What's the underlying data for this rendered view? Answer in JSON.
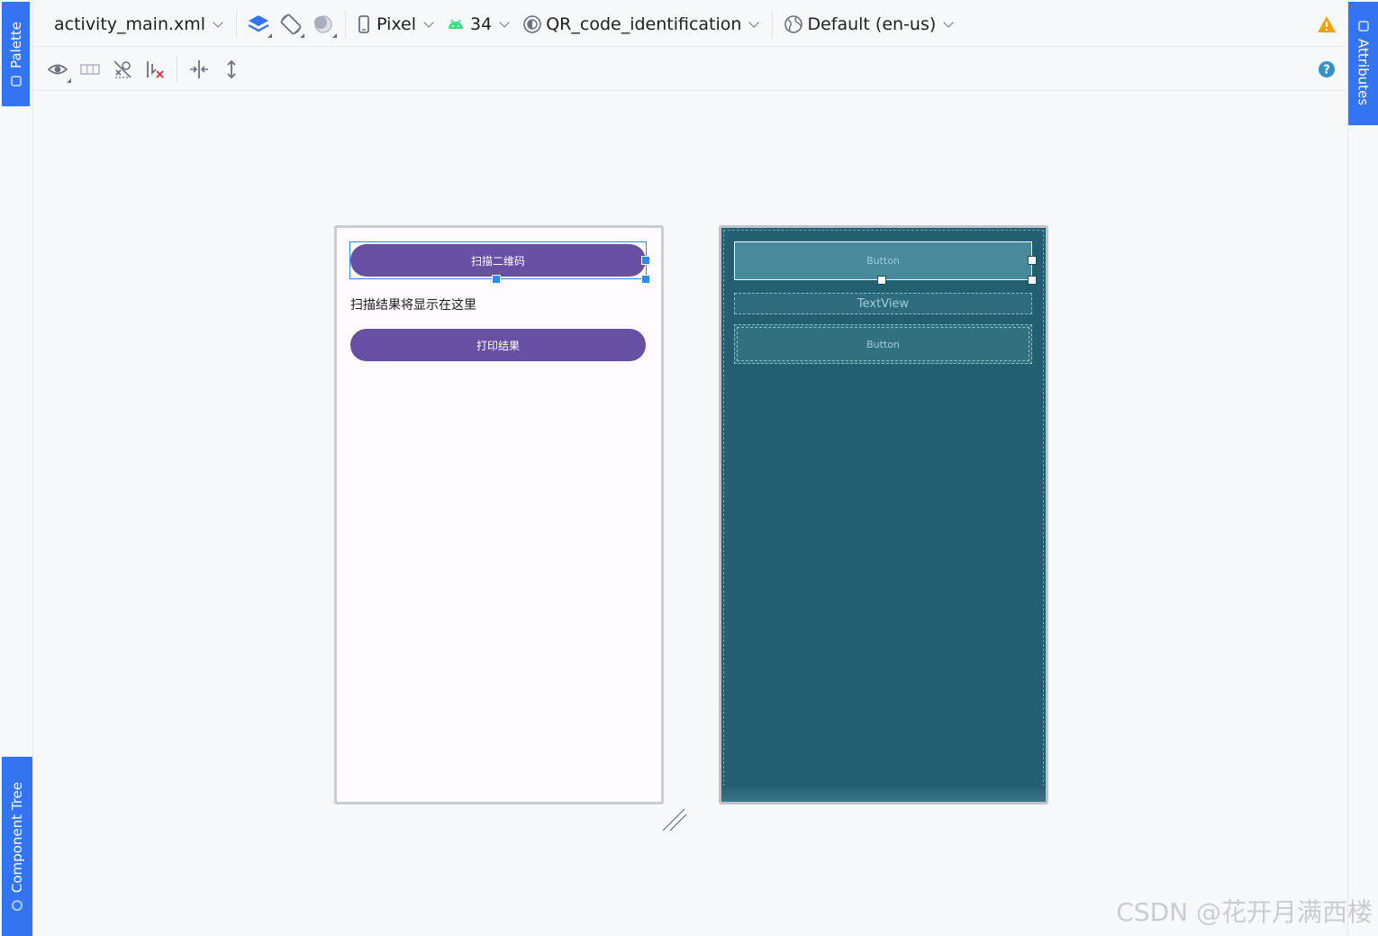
{
  "toolbar": {
    "file_name": "activity_main.xml",
    "device": "Pixel",
    "api_level": "34",
    "theme": "QR_code_identification",
    "locale": "Default (en-us)"
  },
  "side_tabs": {
    "palette": "Palette",
    "component_tree": "Component Tree",
    "attributes": "Attributes"
  },
  "design_view": {
    "scan_button": "扫描二维码",
    "result_text": "扫描结果将显示在这里",
    "print_button": "打印结果"
  },
  "blueprint_view": {
    "button1": "Button",
    "textview": "TextView",
    "button2": "Button"
  },
  "watermark": "CSDN @花开月满西楼",
  "colors": {
    "accent": "#3574f0",
    "m3_primary": "#6750a4",
    "blueprint_bg": "#235e71",
    "selection": "#2b8af7",
    "warning": "#f2a20c",
    "help": "#3592c4",
    "android_green": "#3ddc84"
  },
  "icons": [
    "eye-icon",
    "grid-icon",
    "constraints-off-icon",
    "clear-constraints-icon",
    "expand-horizontal-icon",
    "expand-vertical-icon",
    "layers-icon",
    "orientation-icon",
    "night-mode-icon",
    "phone-icon",
    "android-icon",
    "theme-icon",
    "globe-icon",
    "warning-icon",
    "help-icon"
  ]
}
